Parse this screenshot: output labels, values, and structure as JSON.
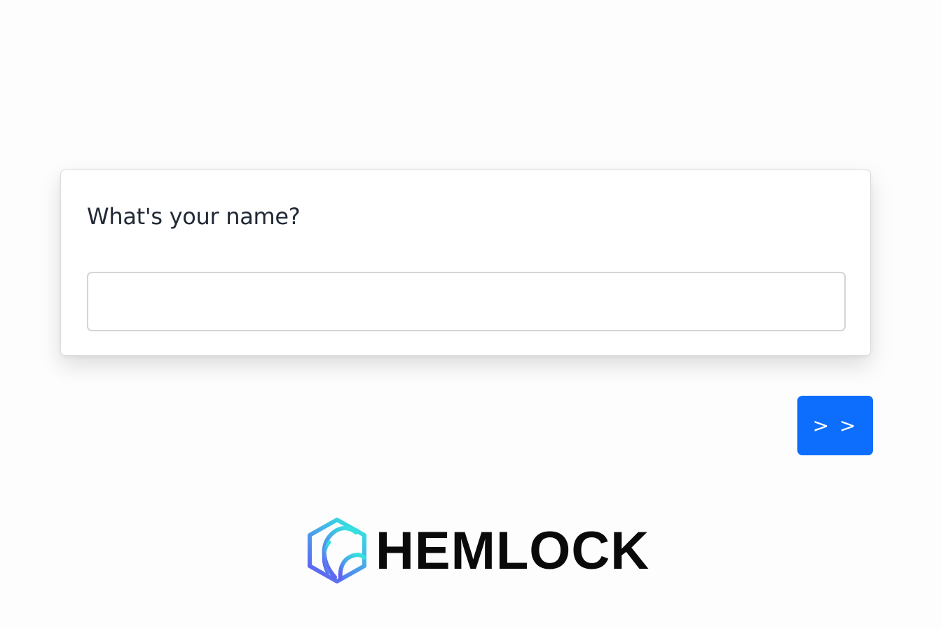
{
  "form": {
    "question": "What's your name?",
    "name_value": ""
  },
  "navigation": {
    "next_label": "> >"
  },
  "brand": {
    "name": "HEMLOCK",
    "icon": "hemlock-hexagon-logo-icon",
    "gradient": [
      "#35e0e0",
      "#5f63f2"
    ]
  }
}
